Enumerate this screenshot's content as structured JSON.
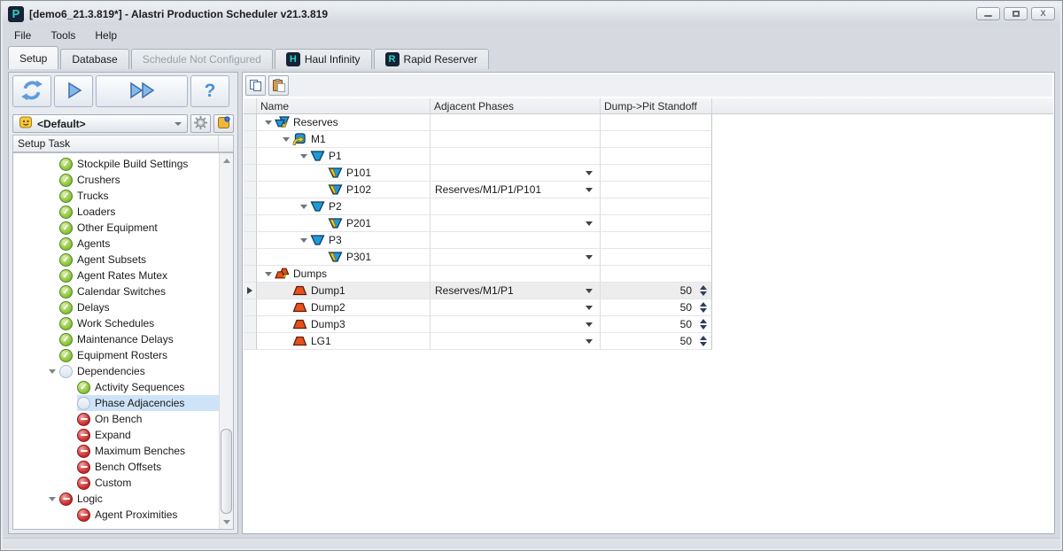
{
  "window": {
    "title": "[demo6_21.3.819*] - Alastri Production Scheduler v21.3.819",
    "app_letter": "P"
  },
  "menu": {
    "items": [
      "File",
      "Tools",
      "Help"
    ]
  },
  "tabs": [
    {
      "label": "Setup",
      "state": "active"
    },
    {
      "label": "Database",
      "state": "normal"
    },
    {
      "label": "Schedule Not Configured",
      "state": "disabled"
    },
    {
      "label": "Haul Infinity",
      "state": "normal",
      "icon_letter": "H"
    },
    {
      "label": "Rapid Reserver",
      "state": "normal",
      "icon_letter": "R"
    }
  ],
  "left_toolbar": {
    "icons": [
      "sync",
      "play",
      "fast-forward",
      "help"
    ],
    "help_glyph": "?"
  },
  "profile": {
    "value": "<Default>"
  },
  "sidebar": {
    "header": "Setup Task",
    "items": [
      {
        "label": "Stockpile Build Settings",
        "status": "done",
        "level": 0
      },
      {
        "label": "Crushers",
        "status": "done",
        "level": 0
      },
      {
        "label": "Trucks",
        "status": "done",
        "level": 0
      },
      {
        "label": "Loaders",
        "status": "done",
        "level": 0
      },
      {
        "label": "Other Equipment",
        "status": "done",
        "level": 0
      },
      {
        "label": "Agents",
        "status": "done",
        "level": 0
      },
      {
        "label": "Agent Subsets",
        "status": "done",
        "level": 0
      },
      {
        "label": "Agent Rates Mutex",
        "status": "done",
        "level": 0
      },
      {
        "label": "Calendar Switches",
        "status": "done",
        "level": 0
      },
      {
        "label": "Delays",
        "status": "done",
        "level": 0
      },
      {
        "label": "Work Schedules",
        "status": "done",
        "level": 0
      },
      {
        "label": "Maintenance Delays",
        "status": "done",
        "level": 0
      },
      {
        "label": "Equipment Rosters",
        "status": "done",
        "level": 0
      },
      {
        "label": "Dependencies",
        "status": "pending",
        "level": 0,
        "expanded": true
      },
      {
        "label": "Activity Sequences",
        "status": "done",
        "level": 1
      },
      {
        "label": "Phase Adjacencies",
        "status": "pending",
        "level": 1,
        "selected": true
      },
      {
        "label": "On Bench",
        "status": "blocked",
        "level": 1
      },
      {
        "label": "Expand",
        "status": "blocked",
        "level": 1
      },
      {
        "label": "Maximum Benches",
        "status": "blocked",
        "level": 1
      },
      {
        "label": "Bench Offsets",
        "status": "blocked",
        "level": 1
      },
      {
        "label": "Custom",
        "status": "blocked",
        "level": 1
      },
      {
        "label": "Logic",
        "status": "blocked",
        "level": 0,
        "expanded": true
      },
      {
        "label": "Agent Proximities",
        "status": "blocked",
        "level": 1
      }
    ]
  },
  "right_toolbar": {
    "icons": [
      "copy",
      "paste"
    ]
  },
  "grid": {
    "columns": [
      "Name",
      "Adjacent Phases",
      "Dump->Pit Standoff"
    ],
    "rows": [
      {
        "name": "Reserves",
        "icon": "pits-group",
        "level": 0,
        "expanded": true
      },
      {
        "name": "M1",
        "icon": "model",
        "level": 1,
        "expanded": true
      },
      {
        "name": "P1",
        "icon": "pit",
        "level": 2,
        "expanded": true
      },
      {
        "name": "P101",
        "icon": "pit-leaf",
        "level": 3,
        "adjacent": "",
        "dropdown": true
      },
      {
        "name": "P102",
        "icon": "pit-leaf",
        "level": 3,
        "adjacent": "Reserves/M1/P1/P101",
        "dropdown": true
      },
      {
        "name": "P2",
        "icon": "pit",
        "level": 2,
        "expanded": true
      },
      {
        "name": "P201",
        "icon": "pit-leaf",
        "level": 3,
        "adjacent": "",
        "dropdown": true
      },
      {
        "name": "P3",
        "icon": "pit",
        "level": 2,
        "expanded": true
      },
      {
        "name": "P301",
        "icon": "pit-leaf",
        "level": 3,
        "adjacent": "",
        "dropdown": true
      },
      {
        "name": "Dumps",
        "icon": "dumps-group",
        "level": 0,
        "expanded": true
      },
      {
        "name": "Dump1",
        "icon": "dump",
        "level": 1,
        "adjacent": "Reserves/M1/P1",
        "dropdown": true,
        "standoff": "50",
        "marker": true,
        "highlight": true
      },
      {
        "name": "Dump2",
        "icon": "dump",
        "level": 1,
        "adjacent": "",
        "dropdown": true,
        "standoff": "50"
      },
      {
        "name": "Dump3",
        "icon": "dump",
        "level": 1,
        "adjacent": "",
        "dropdown": true,
        "standoff": "50"
      },
      {
        "name": "LG1",
        "icon": "dump",
        "level": 1,
        "adjacent": "",
        "dropdown": true,
        "standoff": "50"
      }
    ]
  },
  "colors": {
    "selection": "#cfe3f8",
    "pit_blue": "#1e9bd7",
    "dump_orange": "#e8501e",
    "done_green": "#8fc93f",
    "blocked_red": "#cc3333",
    "accent_teal": "#2fd0c0"
  }
}
